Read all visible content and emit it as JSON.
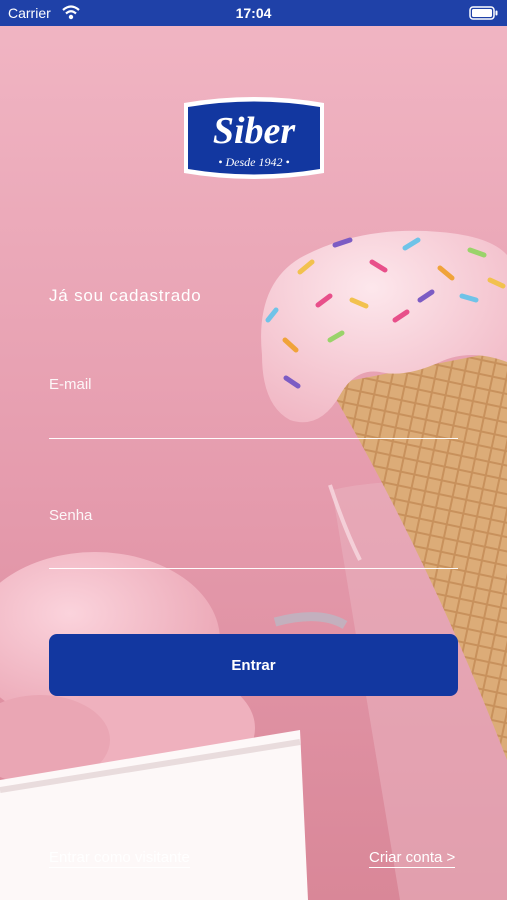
{
  "status_bar": {
    "carrier": "Carrier",
    "time": "17:04",
    "wifi_icon": "wifi-icon",
    "battery_icon": "battery-icon"
  },
  "logo": {
    "brand": "Siber",
    "tagline": "Desde 1942"
  },
  "form": {
    "heading": "Já sou cadastrado",
    "email_label": "E-mail",
    "email_value": "",
    "password_label": "Senha",
    "password_value": ""
  },
  "actions": {
    "login_label": "Entrar",
    "guest_label": "Entrar como visitante",
    "signup_label": "Criar conta >"
  },
  "colors": {
    "status_bar": "#1f41a8",
    "brand_blue": "#1237a0",
    "background_pink": "#e7a3b2"
  }
}
